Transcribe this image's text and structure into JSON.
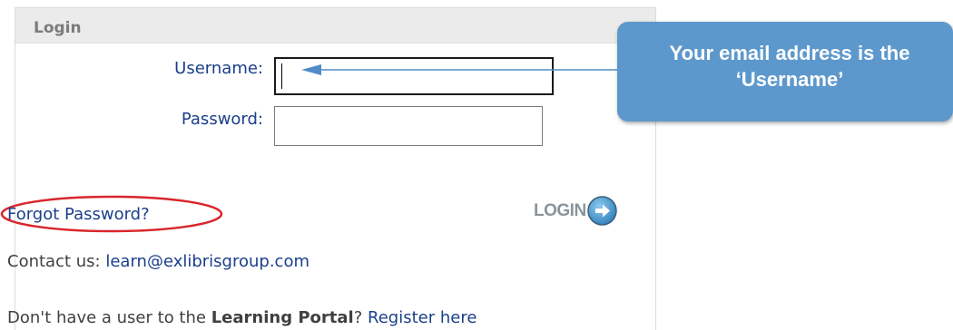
{
  "login": {
    "title": "Login",
    "username_label": "Username:",
    "username_value": "",
    "password_label": "Password:",
    "password_value": "",
    "forgot_password": "Forgot Password?",
    "login_button": "LOGIN",
    "contact_label": "Contact us:",
    "contact_email": "learn@exlibrisgroup.com",
    "register_prefix": "Don't have a user to the",
    "register_bold": "Learning Portal",
    "register_qmark": "?",
    "register_link": "Register here"
  },
  "callout": {
    "line1": "Your email address is the",
    "line2": "‘Username’"
  },
  "icons": {
    "login_arrow": "arrow-right-circle-icon"
  },
  "colors": {
    "callout_bg": "#5d98cc",
    "link": "#1b3f8c",
    "highlight_ellipse": "#d9262c",
    "login_circle": "#5ea6d6"
  }
}
